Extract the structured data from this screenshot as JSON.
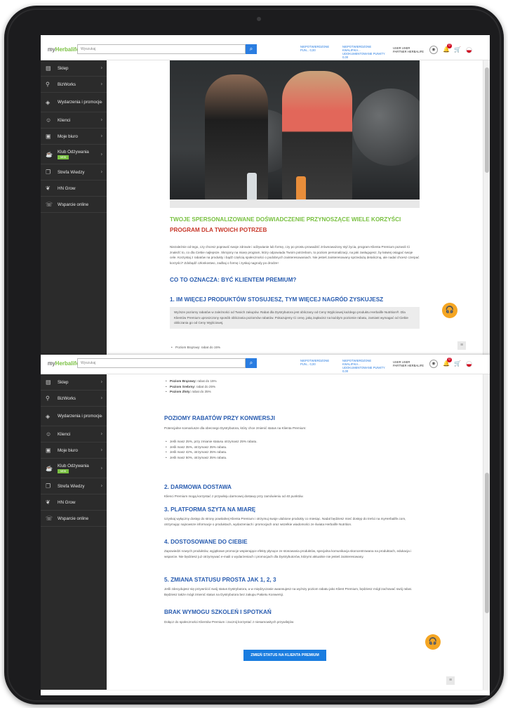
{
  "header": {
    "logo_brand": "my",
    "logo_name": "Herbalife",
    "search_placeholder": "Wyszukaj",
    "link1": "NIEPOTWIERDZONE PUN... 0,00",
    "link2": "NIEPOTWIERDZONE KWALIFIKA... UDOKUMENTOWANE PUNKTY 0,00",
    "user_line1": "USER USER",
    "user_line2": "PARTNER HERBALIFE",
    "bell_count": "0"
  },
  "sidebar": {
    "items": [
      {
        "label": "Sklep",
        "icon": "store-icon"
      },
      {
        "label": "BizWorks",
        "icon": "org-chart-icon"
      },
      {
        "label": "Wydarzenia i promocje",
        "icon": "events-icon"
      },
      {
        "label": "Klienci",
        "icon": "users-icon"
      },
      {
        "label": "Moje biuro",
        "icon": "office-icon"
      },
      {
        "label": "Klub Odżywania",
        "icon": "cup-icon",
        "badge": "NEW"
      },
      {
        "label": "Strefa Wiedzy",
        "icon": "book-icon"
      },
      {
        "label": "HN Grow",
        "icon": "grow-icon"
      },
      {
        "label": "Wsparcie online",
        "icon": "support-icon"
      }
    ]
  },
  "page1": {
    "heading1": "TWOJE SPERSONALIZOWANE DOŚWIADCZENIE PRZYNOSZĄCE WIELE KORZYŚCI",
    "heading2": "PROGRAM DLA TWOICH POTRZEB",
    "intro": "Niezależnie od tego, czy chcesz poprawić swoje zdrowie i odżywianie lub formę, czy po prostu prowadzić zrównoważony styl życia, program Klienta Premium pozwoli Ci znaleźć to, co dla Ciebie najlepsze. Skrojony na miarę program, który odpowiada Twoim potrzebom, to poziom personalizacji, na jaki zasługujesz, by łatwiej osiągać swoje cele. Korzystaj z rabatów na produkty i bądź częścią społeczności o podobnych zainteresowaniach. Nie jesteś zainteresowany sprzedażą detaliczną, ale nadal chcesz czerpać korzyści? Zdobądź członkostwo, zadbaj o formę i zyskaj nagrody po drodze!",
    "heading3": "CO TO OZNACZA: BYĆ KLIENTEM PREMIUM?",
    "heading4": "1. IM WIĘCEJ PRODUKTÓW STOSUJESZ, TYM WIĘCEJ NAGRÓD ZYSKUJESZ",
    "box_text": "Wyższe poziomy rabatów w zależności od Twoich zakupów. Rabat dla Dystrybutora jest obliczany od Ceny Wyjściowej każdego produktu Herbalife Nutrition®. Dla Klientów Premium uproszczony sposób obliczania poziomów rabatów. Pokazujemy Ci cenę, jaką zapłacisz na każdym poziomie rabatu, zamiast wymagać od Ciebie obliczania go od Ceny Wyjściowej.",
    "li1": "Poziom Brązowy: rabat do 15%"
  },
  "page2": {
    "tiers": [
      {
        "name": "Poziom Brązowy:",
        "value": "rabat do 15%"
      },
      {
        "name": "Poziom Srebrny:",
        "value": "rabat do 25%"
      },
      {
        "name": "Poziom Złoty:",
        "value": "rabat do 35%"
      }
    ],
    "conv_heading": "POZIOMY RABATÓW PRZY KONWERSJI",
    "conv_intro": "Potencjalne scenariusze dla obecnego Dystrybutora, który chce zmienić status na Klienta Premium:",
    "conv_items": [
      "Jeśli masz 25%, przy zmianie statusu otrzymasz 25% rabatu.",
      "Jeśli masz 35%, otrzymasz 35% rabatu.",
      "Jeśli masz 42%, otrzymasz 35% rabatu.",
      "Jeśli masz 50%, otrzymasz 35% rabatu."
    ],
    "s2_heading": "2. DARMOWA DOSTAWA",
    "s2_text": "Klienci Premium mogą korzystać z przywileju darmowej dostawy przy zamówieniu od 40 punktów.",
    "s3_heading": "3. PLATFORMA SZYTA NA MIARĘ",
    "s3_text": "Uzyskaj wyłączny dostęp do strony powitalnej Klienta Premium i otrzymuj swoje ulubione produkty co miesiąc. Nadal będziesz mieć dostęp do treści na myHerbalife.com, otrzymując najnowsze informacje o produktach, wydarzeniach i promocjach oraz wszelkie wiadomości ze świata Herbalife Nutrition.",
    "s4_heading": "4. DOSTOSOWANE DO CIEBIE",
    "s4_text": "Zapowiedzi nowych produktów, wyjątkowe promocje wspierające efekty płynące ze stosowania produktów, specjalna komunikacja skoncentrowana na produktach, edukacja i wsparcie. Nie będziesz już otrzymywać e-maili o wydarzeniach i promocjach dla Dystrybutorów, którymi aktualnie nie jesteś zainteresowany.",
    "s5_heading": "5. ZMIANA STATUSU PROSTA JAK 1, 2, 3",
    "s5_text": "Jeśli zdecydujesz się przywrócić swój status Dystrybutora, a w międzyczasie awansujesz na wyższy poziom rabatu jako Klient Premium, będziesz mógł zachować swój rabat. Będziesz także mógł zmienić status na Dystrybutora bez zakupu Pakietu Konwersji.",
    "s6_heading": "BRAK WYMOGU SZKOLEŃ I SPOTKAŃ",
    "s6_text": "Dołącz do społeczności Klientów Premium i zacznij korzystać z niesamowitych przywilejów",
    "cta": "ZMIEŃ STATUS NA KLIENTA PREMIUM"
  },
  "colors": {
    "brand_green": "#7ac142",
    "heading_red": "#c8392b",
    "heading_blue": "#2a5db0",
    "cta_blue": "#1a7de0",
    "sidebar_bg": "#2b2b2b",
    "chat_orange": "#f5a623"
  }
}
